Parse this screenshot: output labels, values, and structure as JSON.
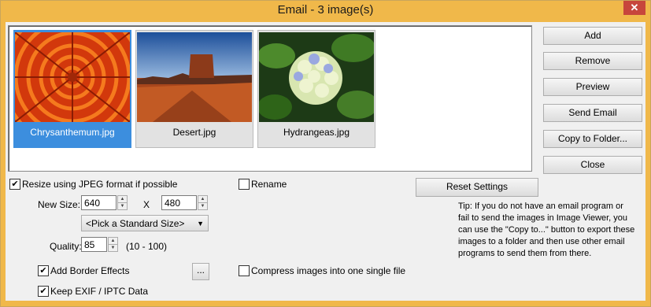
{
  "window": {
    "title": "Email  -  3 image(s)",
    "close_glyph": "✕"
  },
  "images": [
    {
      "caption": "Chrysanthemum.jpg",
      "selected": true
    },
    {
      "caption": "Desert.jpg",
      "selected": false
    },
    {
      "caption": "Hydrangeas.jpg",
      "selected": false
    }
  ],
  "buttons": {
    "add": "Add",
    "remove": "Remove",
    "preview": "Preview",
    "send_email": "Send Email",
    "copy_to_folder": "Copy to Folder...",
    "close": "Close",
    "reset_settings": "Reset Settings",
    "border_more": "..."
  },
  "options": {
    "resize_label": "Resize using JPEG format if possible",
    "resize_checked": true,
    "rename_label": "Rename",
    "rename_checked": false,
    "new_size_label": "New Size:",
    "width_value": "640",
    "times_label": "X",
    "height_value": "480",
    "standard_size": "<Pick a Standard Size>",
    "quality_label": "Quality:",
    "quality_value": "85",
    "quality_range": "(10 - 100)",
    "border_label": "Add Border Effects",
    "border_checked": true,
    "exif_label": "Keep EXIF / IPTC Data",
    "exif_checked": true,
    "compress_label": "Compress images into one single file",
    "compress_checked": false
  },
  "tip": "Tip: If you do not have an email program or fail to send the images in Image Viewer, you can use the \"Copy to...\" button to export these images to a folder and then use other email programs to send them from there."
}
